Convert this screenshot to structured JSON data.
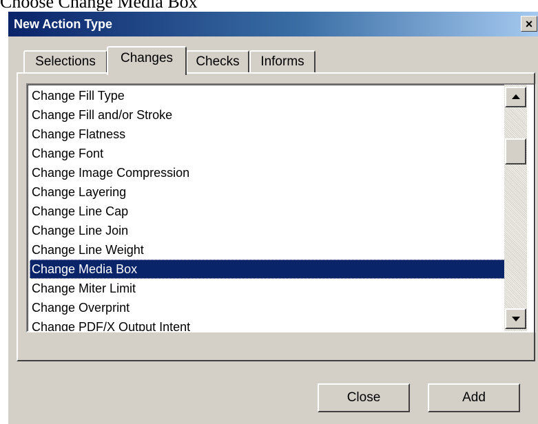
{
  "page_caption": "Choose Change Media Box",
  "dialog": {
    "title": "New Action Type",
    "close_glyph": "×"
  },
  "tabs": [
    {
      "label": "Selections",
      "active": false
    },
    {
      "label": "Changes",
      "active": true
    },
    {
      "label": "Checks",
      "active": false
    },
    {
      "label": "Informs",
      "active": false
    }
  ],
  "list": {
    "items": [
      "Change Fill Type",
      "Change Fill and/or Stroke",
      "Change Flatness",
      "Change Font",
      "Change Image Compression",
      "Change Layering",
      "Change Line Cap",
      "Change Line Join",
      "Change Line Weight",
      "Change Media Box",
      "Change Miter Limit",
      "Change Overprint",
      "Change PDF/X Output Intent"
    ],
    "selected": "Change Media Box"
  },
  "buttons": {
    "close_label": "Close",
    "add_label": "Add"
  },
  "colors": {
    "title_bar": "#0a246a",
    "selection": "#0a246a",
    "face": "#d4d0c8"
  }
}
